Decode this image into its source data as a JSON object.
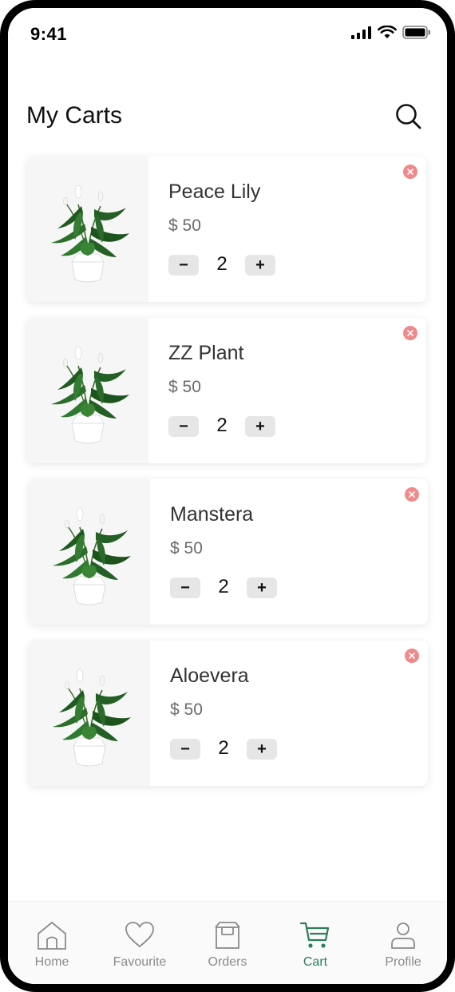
{
  "status_bar": {
    "time": "9:41"
  },
  "header": {
    "title": "My Carts"
  },
  "cart_items": [
    {
      "name": "Peace Lily",
      "price": "$ 50",
      "quantity": "2",
      "decrement": "−",
      "increment": "+"
    },
    {
      "name": "ZZ Plant",
      "price": "$ 50",
      "quantity": "2",
      "decrement": "−",
      "increment": "+"
    },
    {
      "name": "Manstera",
      "price": "$ 50",
      "quantity": "2",
      "decrement": "−",
      "increment": "+"
    },
    {
      "name": "Aloevera",
      "price": "$ 50",
      "quantity": "2",
      "decrement": "−",
      "increment": "+"
    }
  ],
  "bottom_nav": {
    "items": [
      {
        "label": "Home",
        "icon": "home-icon"
      },
      {
        "label": "Favourite",
        "icon": "heart-icon"
      },
      {
        "label": "Orders",
        "icon": "box-icon"
      },
      {
        "label": "Cart",
        "icon": "cart-icon"
      },
      {
        "label": "Profile",
        "icon": "user-icon"
      }
    ],
    "active": "Cart"
  },
  "colors": {
    "accent": "#2e7d5b",
    "remove": "#f08a8a",
    "stepper_bg": "#e6e6e6",
    "nav_inactive": "#8b8b8b"
  }
}
